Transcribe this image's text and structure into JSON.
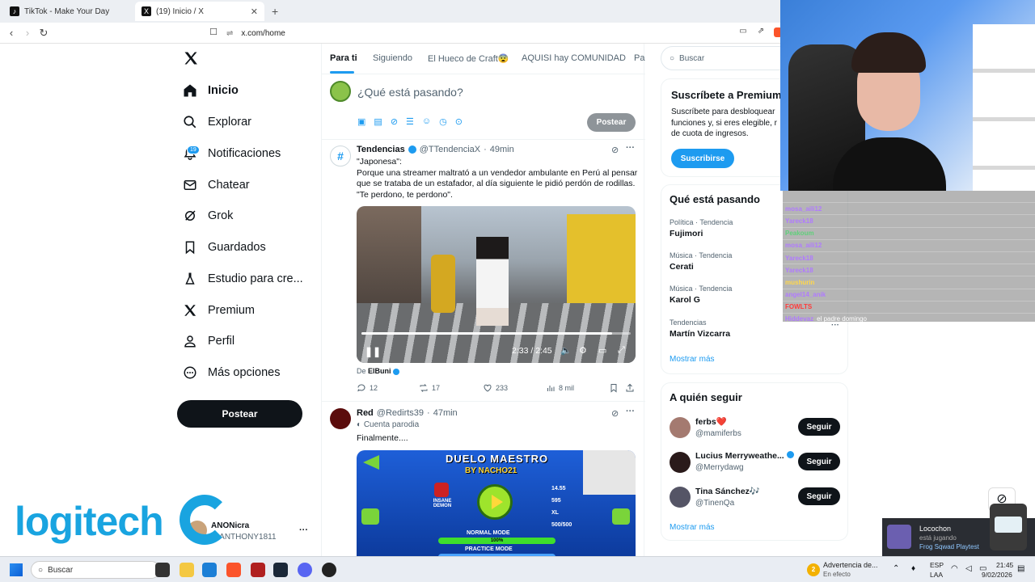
{
  "browser": {
    "tabs": [
      {
        "title": "TikTok - Make Your Day",
        "icon": "tiktok-icon"
      },
      {
        "title": "(19) Inicio / X",
        "icon": "x-logo-icon"
      }
    ],
    "url": "x.com/home"
  },
  "nav": {
    "items": [
      {
        "label": "Inicio",
        "icon": "home-icon"
      },
      {
        "label": "Explorar",
        "icon": "search-icon"
      },
      {
        "label": "Notificaciones",
        "icon": "bell-icon",
        "badge": "19"
      },
      {
        "label": "Chatear",
        "icon": "mail-icon"
      },
      {
        "label": "Grok",
        "icon": "grok-icon"
      },
      {
        "label": "Guardados",
        "icon": "bookmark-icon"
      },
      {
        "label": "Estudio para cre...",
        "icon": "flask-icon"
      },
      {
        "label": "Premium",
        "icon": "x-logo-icon"
      },
      {
        "label": "Perfil",
        "icon": "person-icon"
      },
      {
        "label": "Más opciones",
        "icon": "more-circle-icon"
      }
    ],
    "post_button": "Postear",
    "account": {
      "name": "ANONicra",
      "handle": "@ANTHONY1811"
    }
  },
  "feed": {
    "tabs": [
      "Para ti",
      "Siguiendo",
      "El Hueco de Craft😨",
      "AQUISI hay COMUNIDAD",
      "Pa"
    ],
    "composer": {
      "placeholder": "¿Qué está pasando?",
      "post_button": "Postear"
    },
    "tweet1": {
      "name": "Tendencias",
      "handle": "@TTendenciaX",
      "time": "49min",
      "lines": [
        "\"Japonesa\":",
        "Porque una streamer maltrató a un vendedor ambulante en Perú al pensar",
        "que se trataba de un estafador, al día siguiente le pidió perdón de rodillas.",
        "\"Te perdono, te perdono\"."
      ],
      "video_time": "2:33 / 2:45",
      "progress": 0.93,
      "from_label": "De",
      "from_name": "ElBuni",
      "replies": "12",
      "reposts": "17",
      "likes": "233",
      "views": "8 mil"
    },
    "tweet2": {
      "name": "Red",
      "handle": "@Redirts39",
      "time": "47min",
      "parody": "Cuenta parodia",
      "text": "Finalmente....",
      "game_title": "DUELO MAESTRO",
      "game_by": "BY NACHO21",
      "difficulty": "INSANE DEMON",
      "stats": [
        "14.55",
        "595",
        "XL",
        "500/500"
      ],
      "normal_mode": "NORMAL MODE",
      "normal_pct": "100%",
      "practice_mode": "PRACTICE MODE"
    }
  },
  "sidebar": {
    "search_placeholder": "Buscar",
    "premium": {
      "title": "Suscríbete a Premium",
      "lines": [
        "Suscríbete para desbloquear",
        "funciones y, si eres elegible, r",
        "de cuota de ingresos."
      ],
      "button": "Suscribirse"
    },
    "trends_title": "Qué está pasando",
    "trends": [
      {
        "category": "Política · Tendencia",
        "name": "Fujimori"
      },
      {
        "category": "Música · Tendencia",
        "name": "Cerati"
      },
      {
        "category": "Música · Tendencia",
        "name": "Karol G"
      },
      {
        "category": "Tendencias",
        "name": "Martín Vizcarra"
      }
    ],
    "trends_more": "Mostrar más",
    "who_title": "A quién seguir",
    "who": [
      {
        "name": "ferbs",
        "emoji": "❤️",
        "handle": "@mamiferbs",
        "button": "Seguir"
      },
      {
        "name": "Lucius Merryweathe...",
        "emoji": "",
        "handle": "@Merrydawg",
        "button": "Seguir"
      },
      {
        "name": "Tina Sánchez",
        "emoji": "🎶",
        "handle": "@TinenQa",
        "button": "Seguir"
      }
    ],
    "who_more": "Mostrar más"
  },
  "chat": [
    {
      "user": "",
      "msg": ""
    },
    {
      "user": "mosa_aili12",
      "msg": ""
    },
    {
      "user": "Yareck18",
      "msg": ""
    },
    {
      "user": "Peakoum",
      "msg": ""
    },
    {
      "user": "mosa_aili12",
      "msg": ""
    },
    {
      "user": "Yareck18",
      "msg": ""
    },
    {
      "user": "Yareck18",
      "msg": ""
    },
    {
      "user": "mushurin",
      "msg": ""
    },
    {
      "user": "angel14_anik",
      "msg": ""
    },
    {
      "user": "FOWLTS",
      "msg": ""
    },
    {
      "user": "Hiddevaz",
      "msg": "el padre domingo"
    }
  ],
  "overlay": {
    "logitech": "logitech",
    "notif_title": "Locochon",
    "notif_status": "está jugando",
    "notif_game": "Frog Sqwad Playtest"
  },
  "taskbar": {
    "search": "Buscar",
    "weather_count": "2",
    "weather_title": "Advertencia de...",
    "weather_sub": "En efecto",
    "lang": "ESP",
    "lang2": "LAA",
    "time": "21:45",
    "date": "9/02/2026"
  },
  "colors": {
    "accent": "#1d9bf0",
    "text": "#0f1419",
    "muted": "#536471"
  }
}
